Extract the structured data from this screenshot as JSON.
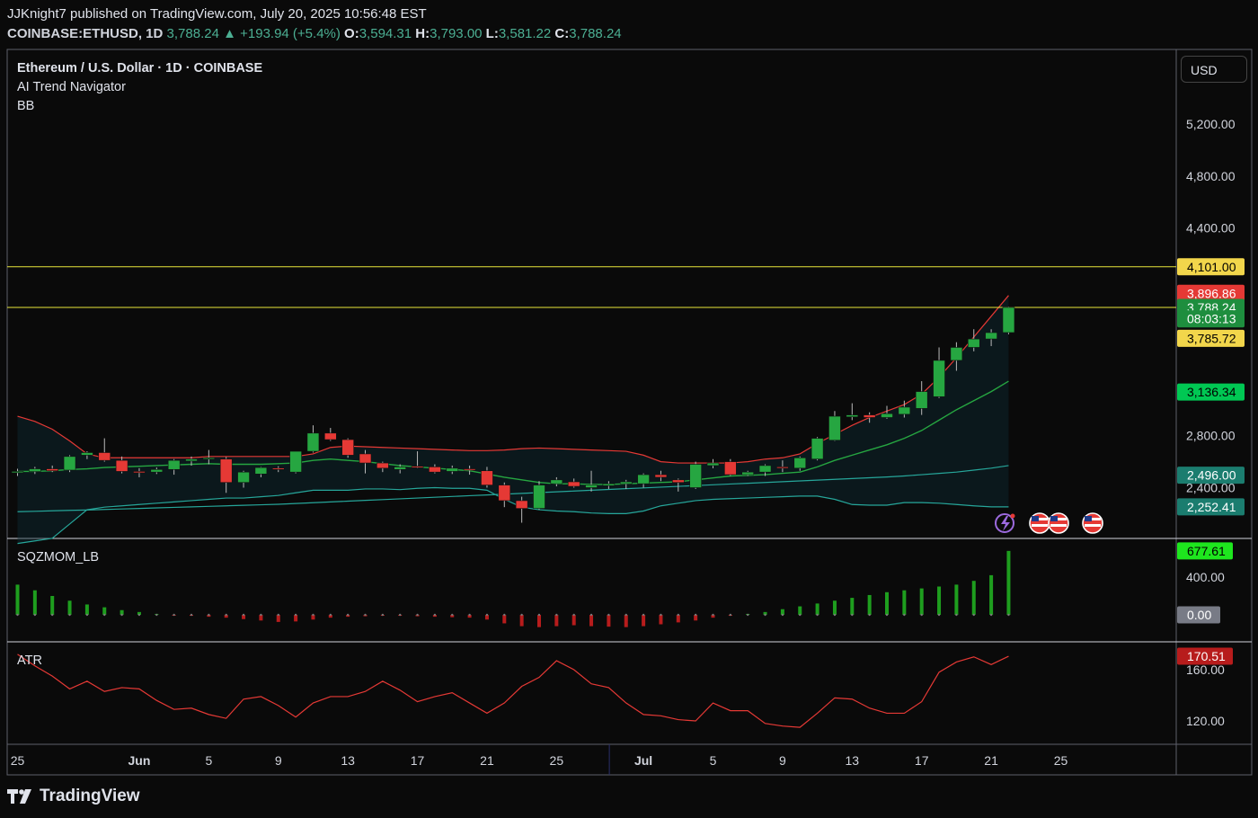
{
  "header": {
    "published_line": "JJKnight7 published on TradingView.com, July 20, 2025 10:56:48 EST",
    "symbol": "COINBASE:ETHUSD, 1D",
    "last": "3,788.24",
    "change": "+193.94 (+5.4%)",
    "open_label": "O:",
    "open": "3,594.31",
    "high_label": "H:",
    "high": "3,793.00",
    "low_label": "L:",
    "low": "3,581.22",
    "close_label": "C:",
    "close": "3,788.24"
  },
  "legend": {
    "main": "Ethereum / U.S. Dollar · 1D · COINBASE",
    "ind1": "AI Trend Navigator",
    "ind2": "BB",
    "sqz": "SQZMOM_LB",
    "atr": "ATR"
  },
  "currency_button": "USD",
  "brand": "TradingView",
  "colors": {
    "up": "#26a641",
    "down": "#e53935",
    "bb_upper": "#e53935",
    "bb_mid": "#26a641",
    "bb_lower": "#26a69a",
    "horizontal_line": "#e8e63a",
    "atr": "#e53935",
    "sqz_up": "#1e9e1e",
    "sqz_down": "#b71c1c"
  },
  "chart_data": [
    {
      "type": "candlestick",
      "title": "Ethereum / U.S. Dollar · 1D · COINBASE",
      "x_ticks": [
        "25",
        "Jun",
        "5",
        "9",
        "13",
        "17",
        "21",
        "25",
        "Jul",
        "5",
        "9",
        "13",
        "17",
        "21",
        "25"
      ],
      "x_tick_days": [
        0,
        7,
        11,
        15,
        19,
        23,
        27,
        31,
        36,
        40,
        44,
        48,
        52,
        56,
        60
      ],
      "y_ticks": [
        "5,200.00",
        "4,800.00",
        "4,400.00",
        "2,800.00",
        "2,400.00"
      ],
      "y_tick_values": [
        5200,
        4800,
        4400,
        2800,
        2400
      ],
      "candles": [
        {
          "o": 2520,
          "h": 2545,
          "l": 2490,
          "c": 2525
        },
        {
          "o": 2525,
          "h": 2560,
          "l": 2505,
          "c": 2545
        },
        {
          "o": 2545,
          "h": 2570,
          "l": 2520,
          "c": 2530
        },
        {
          "o": 2535,
          "h": 2650,
          "l": 2520,
          "c": 2640
        },
        {
          "o": 2650,
          "h": 2680,
          "l": 2620,
          "c": 2670
        },
        {
          "o": 2670,
          "h": 2780,
          "l": 2600,
          "c": 2610
        },
        {
          "o": 2610,
          "h": 2640,
          "l": 2510,
          "c": 2525
        },
        {
          "o": 2525,
          "h": 2550,
          "l": 2480,
          "c": 2520
        },
        {
          "o": 2520,
          "h": 2555,
          "l": 2505,
          "c": 2540
        },
        {
          "o": 2540,
          "h": 2620,
          "l": 2500,
          "c": 2610
        },
        {
          "o": 2605,
          "h": 2640,
          "l": 2570,
          "c": 2620
        },
        {
          "o": 2620,
          "h": 2690,
          "l": 2580,
          "c": 2630
        },
        {
          "o": 2620,
          "h": 2635,
          "l": 2360,
          "c": 2440
        },
        {
          "o": 2440,
          "h": 2530,
          "l": 2400,
          "c": 2520
        },
        {
          "o": 2505,
          "h": 2560,
          "l": 2480,
          "c": 2555
        },
        {
          "o": 2550,
          "h": 2565,
          "l": 2520,
          "c": 2540
        },
        {
          "o": 2520,
          "h": 2680,
          "l": 2510,
          "c": 2680
        },
        {
          "o": 2680,
          "h": 2880,
          "l": 2670,
          "c": 2820
        },
        {
          "o": 2820,
          "h": 2860,
          "l": 2760,
          "c": 2770
        },
        {
          "o": 2770,
          "h": 2780,
          "l": 2630,
          "c": 2650
        },
        {
          "o": 2660,
          "h": 2690,
          "l": 2510,
          "c": 2590
        },
        {
          "o": 2590,
          "h": 2600,
          "l": 2520,
          "c": 2550
        },
        {
          "o": 2540,
          "h": 2580,
          "l": 2510,
          "c": 2560
        },
        {
          "o": 2565,
          "h": 2680,
          "l": 2550,
          "c": 2560
        },
        {
          "o": 2560,
          "h": 2580,
          "l": 2510,
          "c": 2520
        },
        {
          "o": 2525,
          "h": 2570,
          "l": 2505,
          "c": 2550
        },
        {
          "o": 2545,
          "h": 2570,
          "l": 2500,
          "c": 2540
        },
        {
          "o": 2530,
          "h": 2560,
          "l": 2400,
          "c": 2420
        },
        {
          "o": 2420,
          "h": 2440,
          "l": 2250,
          "c": 2300
        },
        {
          "o": 2300,
          "h": 2330,
          "l": 2130,
          "c": 2240
        },
        {
          "o": 2240,
          "h": 2450,
          "l": 2230,
          "c": 2420
        },
        {
          "o": 2430,
          "h": 2480,
          "l": 2410,
          "c": 2460
        },
        {
          "o": 2445,
          "h": 2470,
          "l": 2400,
          "c": 2410
        },
        {
          "o": 2400,
          "h": 2530,
          "l": 2370,
          "c": 2420
        },
        {
          "o": 2415,
          "h": 2450,
          "l": 2390,
          "c": 2430
        },
        {
          "o": 2430,
          "h": 2460,
          "l": 2390,
          "c": 2445
        },
        {
          "o": 2430,
          "h": 2510,
          "l": 2400,
          "c": 2500
        },
        {
          "o": 2500,
          "h": 2530,
          "l": 2450,
          "c": 2480
        },
        {
          "o": 2460,
          "h": 2470,
          "l": 2370,
          "c": 2440
        },
        {
          "o": 2400,
          "h": 2600,
          "l": 2390,
          "c": 2580
        },
        {
          "o": 2570,
          "h": 2620,
          "l": 2550,
          "c": 2590
        },
        {
          "o": 2600,
          "h": 2620,
          "l": 2490,
          "c": 2500
        },
        {
          "o": 2500,
          "h": 2530,
          "l": 2490,
          "c": 2520
        },
        {
          "o": 2520,
          "h": 2580,
          "l": 2490,
          "c": 2570
        },
        {
          "o": 2560,
          "h": 2610,
          "l": 2520,
          "c": 2550
        },
        {
          "o": 2550,
          "h": 2640,
          "l": 2530,
          "c": 2630
        },
        {
          "o": 2620,
          "h": 2790,
          "l": 2610,
          "c": 2780
        },
        {
          "o": 2765,
          "h": 2990,
          "l": 2760,
          "c": 2950
        },
        {
          "o": 2945,
          "h": 3050,
          "l": 2920,
          "c": 2960
        },
        {
          "o": 2960,
          "h": 2980,
          "l": 2900,
          "c": 2940
        },
        {
          "o": 2940,
          "h": 3030,
          "l": 2930,
          "c": 2970
        },
        {
          "o": 2965,
          "h": 3070,
          "l": 2940,
          "c": 3020
        },
        {
          "o": 3010,
          "h": 3220,
          "l": 2960,
          "c": 3140
        },
        {
          "o": 3100,
          "h": 3480,
          "l": 3090,
          "c": 3380
        },
        {
          "o": 3380,
          "h": 3520,
          "l": 3300,
          "c": 3480
        },
        {
          "o": 3480,
          "h": 3620,
          "l": 3450,
          "c": 3545
        },
        {
          "o": 3545,
          "h": 3620,
          "l": 3490,
          "c": 3594
        },
        {
          "o": 3594.31,
          "h": 3793,
          "l": 3581.22,
          "c": 3788.24
        }
      ],
      "horizontal_lines": [
        4101,
        3788.24
      ],
      "bb": {
        "upper": [
          2950,
          2910,
          2850,
          2760,
          2660,
          2630,
          2630,
          2630,
          2630,
          2630,
          2630,
          2640,
          2640,
          2640,
          2640,
          2640,
          2640,
          2660,
          2710,
          2720,
          2715,
          2710,
          2705,
          2700,
          2695,
          2690,
          2685,
          2685,
          2690,
          2700,
          2705,
          2700,
          2695,
          2690,
          2685,
          2680,
          2650,
          2600,
          2590,
          2590,
          2590,
          2590,
          2600,
          2620,
          2630,
          2660,
          2740,
          2810,
          2880,
          2940,
          2990,
          3040,
          3120,
          3250,
          3400,
          3560,
          3720,
          3880
        ],
        "basis": [
          2525,
          2525,
          2530,
          2540,
          2545,
          2555,
          2560,
          2565,
          2570,
          2575,
          2580,
          2585,
          2580,
          2580,
          2580,
          2585,
          2590,
          2610,
          2620,
          2610,
          2600,
          2585,
          2570,
          2560,
          2550,
          2540,
          2530,
          2505,
          2480,
          2460,
          2440,
          2430,
          2430,
          2425,
          2425,
          2430,
          2435,
          2440,
          2445,
          2460,
          2475,
          2490,
          2495,
          2500,
          2510,
          2520,
          2560,
          2610,
          2650,
          2690,
          2730,
          2780,
          2840,
          2920,
          3000,
          3070,
          3140,
          3220
        ],
        "lower": [
          1970,
          1990,
          2010,
          2120,
          2230,
          2250,
          2260,
          2270,
          2280,
          2290,
          2300,
          2310,
          2320,
          2320,
          2330,
          2340,
          2360,
          2380,
          2380,
          2380,
          2390,
          2390,
          2385,
          2395,
          2400,
          2395,
          2395,
          2380,
          2310,
          2250,
          2230,
          2220,
          2215,
          2205,
          2200,
          2200,
          2220,
          2260,
          2280,
          2300,
          2310,
          2315,
          2320,
          2325,
          2330,
          2335,
          2335,
          2310,
          2270,
          2265,
          2265,
          2285,
          2285,
          2280,
          2270,
          2260,
          2252,
          2252
        ]
      },
      "trend_line": {
        "values": [
          2215,
          2218,
          2222,
          2225,
          2228,
          2232,
          2236,
          2240,
          2244,
          2248,
          2252,
          2256,
          2260,
          2264,
          2268,
          2272,
          2278,
          2284,
          2290,
          2296,
          2302,
          2308,
          2314,
          2320,
          2326,
          2332,
          2338,
          2344,
          2350,
          2356,
          2362,
          2368,
          2374,
          2380,
          2386,
          2392,
          2398,
          2404,
          2410,
          2416,
          2422,
          2428,
          2434,
          2440,
          2446,
          2452,
          2458,
          2464,
          2470,
          2476,
          2482,
          2490,
          2500,
          2510,
          2520,
          2535,
          2550,
          2570
        ]
      },
      "price_labels": [
        {
          "text": "4,101.00",
          "value": 4101,
          "bg": "#f2d64b",
          "fg": "#000000"
        },
        {
          "text": "3,896.86",
          "value": 3896.86,
          "bg": "#e53935",
          "fg": "#ffffff"
        },
        {
          "text": "3,788.24",
          "value": 3788.24,
          "bg": "#1e8e3e",
          "fg": "#ffffff"
        },
        {
          "text": "08:03:13",
          "value": 3700,
          "bg": "#1e8e3e",
          "fg": "#ffffff"
        },
        {
          "text": "3,785.72",
          "value": 3550,
          "bg": "#f2d64b",
          "fg": "#000000"
        },
        {
          "text": "3,136.34",
          "value": 3136.34,
          "bg": "#00c853",
          "fg": "#000000"
        },
        {
          "text": "2,496.00",
          "value": 2496,
          "bg": "#1b7d6f",
          "fg": "#ffffff"
        },
        {
          "text": "2,252.41",
          "value": 2252.41,
          "bg": "#1b7d6f",
          "fg": "#ffffff"
        }
      ]
    },
    {
      "type": "bar",
      "title": "SQZMOM_LB",
      "y_ticks": [
        "400.00"
      ],
      "y_tick_values": [
        400
      ],
      "last_label": {
        "text": "677.61",
        "bg": "#1ee61e",
        "fg": "#000000"
      },
      "zero_label": {
        "text": "0.00",
        "bg": "#787b86",
        "fg": "#ffffff"
      },
      "values": [
        320,
        260,
        200,
        150,
        110,
        80,
        50,
        30,
        10,
        -5,
        -10,
        -20,
        -30,
        -45,
        -60,
        -75,
        -70,
        -50,
        -30,
        -20,
        -15,
        -10,
        -10,
        -15,
        -20,
        -25,
        -30,
        -50,
        -90,
        -120,
        -130,
        -120,
        -110,
        -120,
        -125,
        -130,
        -120,
        -100,
        -80,
        -60,
        -30,
        -10,
        10,
        30,
        60,
        90,
        120,
        150,
        180,
        210,
        240,
        260,
        280,
        300,
        320,
        360,
        420,
        677.61
      ]
    },
    {
      "type": "line",
      "title": "ATR",
      "y_ticks": [
        "160.00",
        "120.00"
      ],
      "y_tick_values": [
        160,
        120
      ],
      "last_label": {
        "text": "170.51",
        "bg": "#b71c1c",
        "fg": "#ffffff"
      },
      "values": [
        172,
        163,
        155,
        145,
        151,
        143,
        146,
        145,
        136,
        129,
        130,
        125,
        122,
        137,
        139,
        132,
        123,
        134,
        139,
        139,
        143,
        151,
        144,
        135,
        139,
        142,
        134,
        126,
        134,
        147,
        154,
        167,
        160,
        149,
        146,
        134,
        125,
        124,
        121,
        120,
        134,
        128,
        128,
        118,
        116,
        115,
        126,
        138,
        137,
        130,
        126,
        126,
        135,
        158,
        166,
        170,
        164,
        170.51
      ]
    }
  ]
}
